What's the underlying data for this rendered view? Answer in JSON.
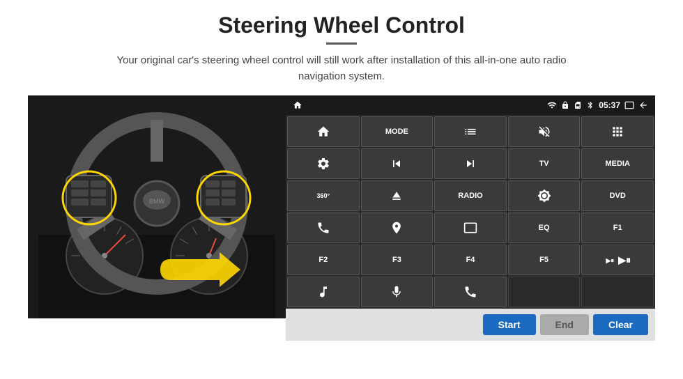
{
  "page": {
    "title": "Steering Wheel Control",
    "subtitle": "Your original car's steering wheel control will still work after installation of this all-in-one auto radio navigation system."
  },
  "status_bar": {
    "time": "05:37",
    "icons": [
      "wifi",
      "lock",
      "sim",
      "bluetooth",
      "screen",
      "back"
    ]
  },
  "buttons": [
    [
      {
        "id": "home",
        "type": "icon",
        "label": "home"
      },
      {
        "id": "mode",
        "type": "text",
        "label": "MODE"
      },
      {
        "id": "list",
        "type": "icon",
        "label": "list"
      },
      {
        "id": "mute",
        "type": "icon",
        "label": "mute"
      },
      {
        "id": "apps",
        "type": "icon",
        "label": "apps"
      }
    ],
    [
      {
        "id": "settings",
        "type": "icon",
        "label": "settings"
      },
      {
        "id": "prev",
        "type": "icon",
        "label": "prev"
      },
      {
        "id": "next",
        "type": "icon",
        "label": "next"
      },
      {
        "id": "tv",
        "type": "text",
        "label": "TV"
      },
      {
        "id": "media",
        "type": "text",
        "label": "MEDIA"
      }
    ],
    [
      {
        "id": "cam360",
        "type": "icon",
        "label": "360"
      },
      {
        "id": "eject",
        "type": "icon",
        "label": "eject"
      },
      {
        "id": "radio",
        "type": "text",
        "label": "RADIO"
      },
      {
        "id": "brightness",
        "type": "icon",
        "label": "brightness"
      },
      {
        "id": "dvd",
        "type": "text",
        "label": "DVD"
      }
    ],
    [
      {
        "id": "phone",
        "type": "icon",
        "label": "phone"
      },
      {
        "id": "nav",
        "type": "icon",
        "label": "nav"
      },
      {
        "id": "screen_fit",
        "type": "icon",
        "label": "screen"
      },
      {
        "id": "eq",
        "type": "text",
        "label": "EQ"
      },
      {
        "id": "f1",
        "type": "text",
        "label": "F1"
      }
    ],
    [
      {
        "id": "f2",
        "type": "text",
        "label": "F2"
      },
      {
        "id": "f3",
        "type": "text",
        "label": "F3"
      },
      {
        "id": "f4",
        "type": "text",
        "label": "F4"
      },
      {
        "id": "f5",
        "type": "text",
        "label": "F5"
      },
      {
        "id": "play_pause",
        "type": "icon",
        "label": "play/pause"
      }
    ],
    [
      {
        "id": "music",
        "type": "icon",
        "label": "music"
      },
      {
        "id": "mic",
        "type": "icon",
        "label": "mic"
      },
      {
        "id": "call_end",
        "type": "icon",
        "label": "call_end"
      },
      {
        "id": "empty1",
        "type": "text",
        "label": ""
      },
      {
        "id": "empty2",
        "type": "text",
        "label": ""
      }
    ]
  ],
  "bottom_buttons": {
    "start": "Start",
    "end": "End",
    "clear": "Clear"
  }
}
